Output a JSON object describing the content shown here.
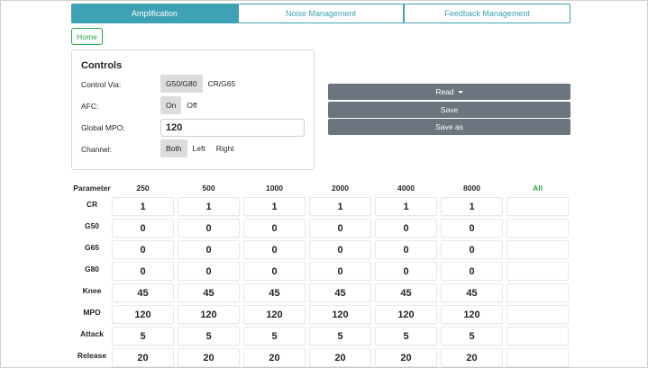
{
  "tabs": [
    {
      "label": "Amplification",
      "active": true
    },
    {
      "label": "Noise Management",
      "active": false
    },
    {
      "label": "Feedback Management",
      "active": false
    }
  ],
  "home_label": "Home",
  "controls": {
    "title": "Controls",
    "control_via": {
      "label": "Control Via:",
      "options": [
        "G50/G80",
        "CR/G65"
      ],
      "selected": "G50/G80"
    },
    "afc": {
      "label": "AFC:",
      "options": [
        "On",
        "Off"
      ],
      "selected": "On"
    },
    "global_mpo": {
      "label": "Global MPO:",
      "value": "120"
    },
    "channel": {
      "label": "Channel:",
      "options": [
        "Both",
        "Left",
        "Right"
      ],
      "selected": "Both"
    }
  },
  "actions": {
    "read": "Read",
    "save": "Save",
    "save_as": "Save as"
  },
  "table": {
    "param_header": "Parameter",
    "frequencies": [
      "250",
      "500",
      "1000",
      "2000",
      "4000",
      "8000"
    ],
    "all_label": "All",
    "rows": [
      {
        "name": "CR",
        "values": [
          "1",
          "1",
          "1",
          "1",
          "1",
          "1"
        ]
      },
      {
        "name": "G50",
        "values": [
          "0",
          "0",
          "0",
          "0",
          "0",
          "0"
        ]
      },
      {
        "name": "G65",
        "values": [
          "0",
          "0",
          "0",
          "0",
          "0",
          "0"
        ]
      },
      {
        "name": "G80",
        "values": [
          "0",
          "0",
          "0",
          "0",
          "0",
          "0"
        ]
      },
      {
        "name": "Knee",
        "values": [
          "45",
          "45",
          "45",
          "45",
          "45",
          "45"
        ]
      },
      {
        "name": "MPO",
        "values": [
          "120",
          "120",
          "120",
          "120",
          "120",
          "120"
        ]
      },
      {
        "name": "Attack",
        "values": [
          "5",
          "5",
          "5",
          "5",
          "5",
          "5"
        ]
      },
      {
        "name": "Release",
        "values": [
          "20",
          "20",
          "20",
          "20",
          "20",
          "20"
        ]
      }
    ]
  },
  "colors": {
    "accent": "#3fa1b5",
    "success": "#28a745",
    "secondary": "#6c757d"
  }
}
